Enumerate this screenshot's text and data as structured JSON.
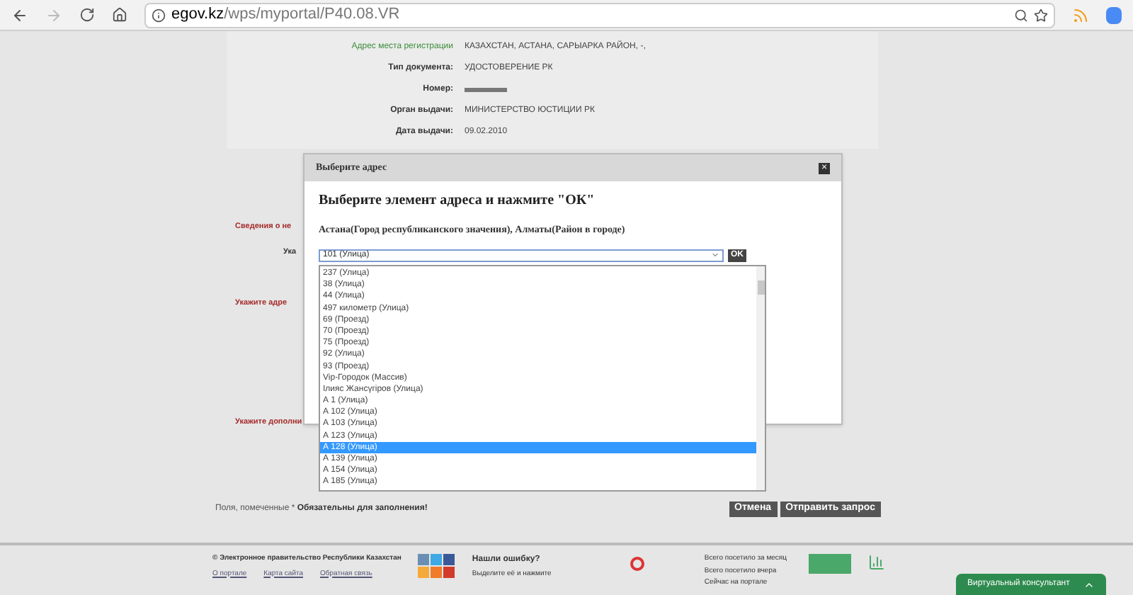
{
  "browser": {
    "url_host": "egov.kz",
    "url_path": "/wps/myportal/P40.08.VR"
  },
  "info_rows": [
    {
      "label": "Адрес места регистрации",
      "value": "КАЗАХСТАН, АСТАНА, САРЫАРКА РАЙОН, -,",
      "kind": "green"
    },
    {
      "label": "Тип документа:",
      "value": "УДОСТОВЕРЕНИЕ РК",
      "kind": "plain"
    },
    {
      "label": "Номер:",
      "value": "",
      "kind": "plain"
    },
    {
      "label": "Орган выдачи:",
      "value": "МИНИСТЕРСТВО ЮСТИЦИИ РК",
      "kind": "plain"
    },
    {
      "label": "Дата выдачи:",
      "value": "09.02.2010",
      "kind": "plain"
    }
  ],
  "form": {
    "section_1": "Сведения о не",
    "field_1": "Ука",
    "section_2": "Укажите адре",
    "section_3": "Укажите дополни",
    "required_note_plain": "Поля, помеченные * ",
    "required_note_bold": "Обязательны для заполнения!",
    "cancel": "Отмена",
    "submit": "Отправить запрос"
  },
  "dialog": {
    "title": "Выберите адрес",
    "close": "×",
    "heading": "Выберите элемент адреса и нажмите \"ОК\"",
    "path": "Астана(Город республиканского значения), Алматы(Район в городе)",
    "select_value": "101 (Улица)",
    "ok": "OK",
    "options": [
      {
        "label": "237 (Улица)",
        "selected": false
      },
      {
        "label": "38 (Улица)",
        "selected": false
      },
      {
        "label": "44 (Улица)",
        "selected": false
      },
      {
        "label": "497 километр (Улица)",
        "selected": false
      },
      {
        "label": "69 (Проезд)",
        "selected": false
      },
      {
        "label": "70 (Проезд)",
        "selected": false
      },
      {
        "label": "75 (Проезд)",
        "selected": false
      },
      {
        "label": "92 (Улица)",
        "selected": false
      },
      {
        "label": "93 (Проезд)",
        "selected": false
      },
      {
        "label": "Vip-Городок (Массив)",
        "selected": false
      },
      {
        "label": "Ілияс Жансүгіров (Улица)",
        "selected": false
      },
      {
        "label": "А 1 (Улица)",
        "selected": false
      },
      {
        "label": "А 102 (Улица)",
        "selected": false
      },
      {
        "label": "А 103 (Улица)",
        "selected": false
      },
      {
        "label": "А 123 (Улица)",
        "selected": false
      },
      {
        "label": "А 128 (Улица)",
        "selected": true
      },
      {
        "label": "А 139 (Улица)",
        "selected": false
      },
      {
        "label": "А 154 (Улица)",
        "selected": false
      },
      {
        "label": "А 185 (Улица)",
        "selected": false
      }
    ]
  },
  "footer": {
    "copyright": "© Электронное правительство Республики Казахстан",
    "links": [
      "О портале",
      "Карта сайта",
      "Обратная связь"
    ],
    "error_title": "Нашли ошибку?",
    "error_hint": "Выделите её и нажмите",
    "stats": [
      "Всего посетило за месяц",
      "Всего посетило вчера",
      "Сейчас на портале"
    ],
    "consultant": "Виртуальный консультант"
  }
}
